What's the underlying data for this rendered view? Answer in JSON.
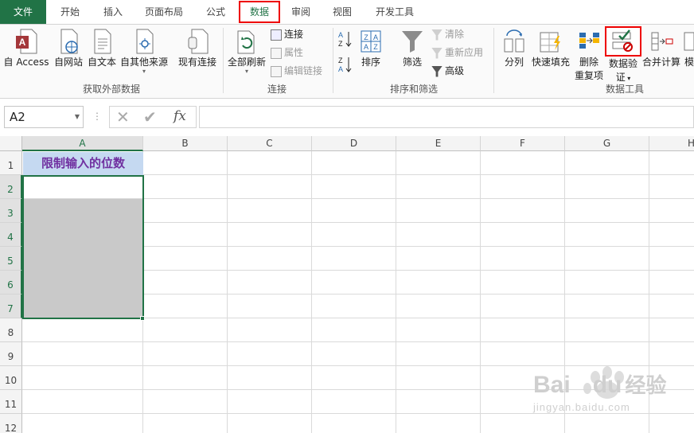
{
  "tabs": [
    {
      "label": "文件"
    },
    {
      "label": "开始"
    },
    {
      "label": "插入"
    },
    {
      "label": "页面布局"
    },
    {
      "label": "公式"
    },
    {
      "label": "数据"
    },
    {
      "label": "审阅"
    },
    {
      "label": "视图"
    },
    {
      "label": "开发工具"
    }
  ],
  "ribbon": {
    "get_external": {
      "access": "自 Access",
      "web": "自网站",
      "text": "自文本",
      "other": "自其他来源",
      "existing": "现有连接",
      "group_label": "获取外部数据"
    },
    "connections": {
      "refresh_all": "全部刷新",
      "connections": "连接",
      "properties": "属性",
      "edit_links": "编辑链接",
      "group_label": "连接"
    },
    "sort_filter": {
      "sort": "排序",
      "filter": "筛选",
      "clear": "清除",
      "reapply": "重新应用",
      "advanced": "高级",
      "group_label": "排序和筛选"
    },
    "data_tools": {
      "text_to_columns": "分列",
      "flash_fill": "快速填充",
      "remove_dup_1": "删除",
      "remove_dup_2": "重复项",
      "validation_1": "数据验",
      "validation_2": "证",
      "consolidate": "合并计算",
      "what_if": "模",
      "group_label": "数据工具"
    }
  },
  "formula_bar": {
    "name_box": "A2",
    "fx": "fx",
    "formula": ""
  },
  "grid": {
    "columns": [
      "A",
      "B",
      "C",
      "D",
      "E",
      "F",
      "G",
      "H"
    ],
    "rows": [
      "1",
      "2",
      "3",
      "4",
      "5",
      "6",
      "7",
      "8",
      "9",
      "10",
      "11",
      "12"
    ],
    "a1": "限制输入的位数"
  },
  "watermark": {
    "brand": "Bai",
    "brand2": "du",
    "brand3": "经验",
    "url": "jingyan.baidu.com"
  },
  "colors": {
    "accent": "#217346",
    "highlight_box": "#e00000",
    "header_fill": "#c5d9f1",
    "header_text": "#7030a0",
    "selection_fill": "#c9c9c9"
  }
}
